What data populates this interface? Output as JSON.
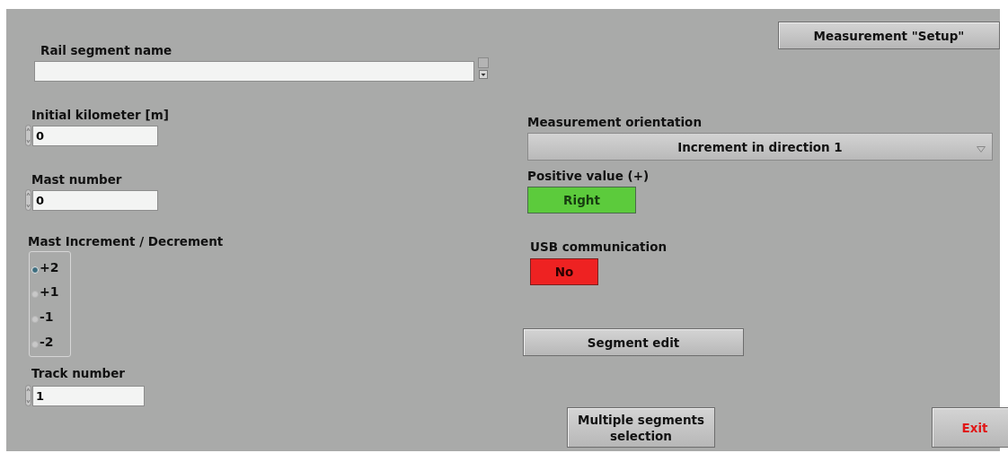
{
  "rail_segment_name": {
    "label": "Rail segment name"
  },
  "initial_kilometer": {
    "label": "Initial kilometer [m]",
    "value": "0"
  },
  "mast_number": {
    "label": "Mast number",
    "value": "0"
  },
  "mast_increment": {
    "label": "Mast Increment / Decrement",
    "options": [
      {
        "label": "+2",
        "selected": true
      },
      {
        "label": "+1",
        "selected": false
      },
      {
        "label": "-1",
        "selected": false
      },
      {
        "label": "-2",
        "selected": false
      }
    ]
  },
  "track_number": {
    "label": "Track number",
    "value": "1"
  },
  "setup_button": "Measurement \"Setup\"",
  "measurement_orientation": {
    "label": "Measurement orientation",
    "value": "Increment in direction 1"
  },
  "positive_value": {
    "label": "Positive value (+)",
    "value": "Right",
    "color": "#5ccb3c"
  },
  "usb_communication": {
    "label": "USB communication",
    "value": "No",
    "color": "#ee2222"
  },
  "segment_edit_button": "Segment edit",
  "multiple_segments_button": "Multiple segments selection",
  "exit_button": "Exit"
}
